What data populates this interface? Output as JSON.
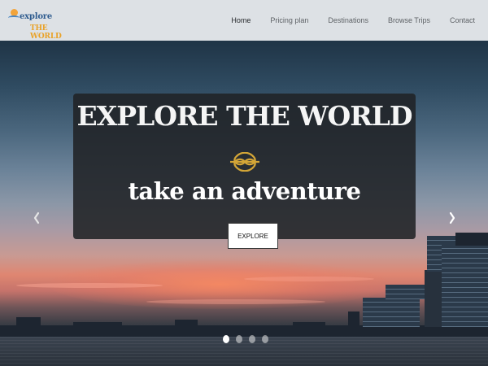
{
  "logo": {
    "line1": "explore",
    "line2": "THE WORLD"
  },
  "nav": {
    "items": [
      {
        "label": "Home",
        "active": true
      },
      {
        "label": "Pricing plan",
        "active": false
      },
      {
        "label": "Destinations",
        "active": false
      },
      {
        "label": "Browse Trips",
        "active": false
      },
      {
        "label": "Contact",
        "active": false
      }
    ]
  },
  "hero": {
    "title": "EXPLORE THE WORLD",
    "subtitle": "take an adventure",
    "button_label": "EXPLORE",
    "divider_icon": "rope-knot-icon",
    "prev_icon": "chevron-left-icon",
    "next_icon": "chevron-right-icon",
    "slides_count": 4,
    "active_slide": 1
  },
  "colors": {
    "navbar_bg": "#dde1e5",
    "caption_bg": "#202225",
    "knot_gold": "#d4a637",
    "logo_blue": "#2f5c8f",
    "logo_orange": "#e9a228"
  }
}
